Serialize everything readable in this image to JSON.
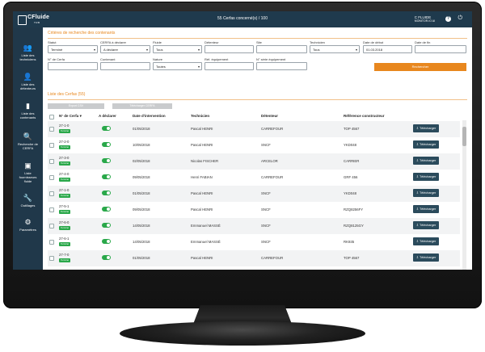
{
  "topbar": {
    "logo_text": "CFluide",
    "logo_sub": "TRB",
    "title": "55 Cerfas concerné(s) / 100",
    "user_name": "C FLUIDE",
    "user_sub": "MONITOR.IO AI"
  },
  "sidebar": [
    {
      "icon": "users-icon",
      "glyph": "👥",
      "label": [
        "Liste des",
        "techniciens"
      ]
    },
    {
      "icon": "user-icon",
      "glyph": "👤",
      "label": [
        "Liste des",
        "détenteurs"
      ]
    },
    {
      "icon": "container-icon",
      "glyph": "▮",
      "label": [
        "Liste des",
        "contenants"
      ]
    },
    {
      "icon": "search-icon",
      "glyph": "🔍",
      "label": [
        "Recherche de",
        "CERFA"
      ]
    },
    {
      "icon": "contact-icon",
      "glyph": "▣",
      "label": [
        "Liste",
        "fournisseurs",
        "fluide"
      ]
    },
    {
      "icon": "wrench-icon",
      "glyph": "🔧",
      "label": [
        "Outillages"
      ]
    },
    {
      "icon": "gear-icon",
      "glyph": "⚙",
      "label": [
        "Paramètres"
      ]
    }
  ],
  "search": {
    "section_title": "Critères de recherche des contenants",
    "fields": {
      "statut": {
        "label": "Statut",
        "value": "Terminé"
      },
      "cerfa": {
        "label": "CERFA à déclarer",
        "value": "A déclarer"
      },
      "fluide": {
        "label": "Fluide",
        "value": "Tous"
      },
      "detenteur": {
        "label": "Détenteur",
        "value": ""
      },
      "site": {
        "label": "Site",
        "value": ""
      },
      "technicien": {
        "label": "Technicien",
        "value": "Tous"
      },
      "date_debut": {
        "label": "Date de début",
        "value": "01.03.2018"
      },
      "date_fin": {
        "label": "Date de fin",
        "value": ""
      },
      "num_cerfa": {
        "label": "N° de Cerfa",
        "value": ""
      },
      "contenant": {
        "label": "Contenant",
        "value": ""
      },
      "nature": {
        "label": "Nature",
        "value": "Toutes"
      },
      "ref_equip": {
        "label": "Réf. équipement",
        "value": ""
      },
      "serie_equip": {
        "label": "N° série équipement",
        "value": ""
      }
    },
    "button": "Rechercher"
  },
  "list": {
    "section_title": "Liste des Cerfas (55)",
    "btn_export": "Export CSV",
    "btn_download": "Télécharger CERFA",
    "headers": {
      "num": "N° de Cerfa",
      "declare": "A déclarer",
      "date": "Date d'intervention",
      "tech": "Technicien",
      "owner": "Détenteur",
      "ref": "Référence constructeur"
    },
    "badge": "Terminé",
    "download": "Télécharger",
    "rows": [
      {
        "num": "27-1-0",
        "date": "01/05/2018",
        "tech": "Pascal HENRI",
        "owner": "CARREFOUR",
        "ref": "TOP 4567"
      },
      {
        "num": "27-2-0",
        "date": "10/05/2018",
        "tech": "Pascal HENRI",
        "owner": "SNCF",
        "ref": "YKD048"
      },
      {
        "num": "27-3-0",
        "date": "02/05/2018",
        "tech": "Nicolas FISCHER",
        "owner": "ARCELOR",
        "ref": "CARRIER"
      },
      {
        "num": "27-4-0",
        "date": "09/05/2018",
        "tech": "Henri FABIAN",
        "owner": "CARREFOUR",
        "ref": "GRF 456"
      },
      {
        "num": "27-1-0",
        "date": "01/05/2018",
        "tech": "Pascal HENRI",
        "owner": "SNCF",
        "ref": "YKD048"
      },
      {
        "num": "27-5-1",
        "date": "09/05/2018",
        "tech": "Pascal HENRI",
        "owner": "SNCF",
        "ref": "RZQ8256FY"
      },
      {
        "num": "27-6-0",
        "date": "14/05/2018",
        "tech": "Emmanuel MASSÉ",
        "owner": "SNCF",
        "ref": "RZQ8125GY"
      },
      {
        "num": "27-6-1",
        "date": "14/05/2018",
        "tech": "Emmanuel MASSÉ",
        "owner": "SNCF",
        "ref": "RK935"
      },
      {
        "num": "27-7-0",
        "date": "01/05/2018",
        "tech": "Pascal HENRI",
        "owner": "CARREFOUR",
        "ref": "TOP 4567"
      }
    ]
  },
  "colors": {
    "accent": "#e8871e",
    "nav": "#20384a",
    "success": "#2aa84a",
    "button": "#2b4b5c"
  }
}
